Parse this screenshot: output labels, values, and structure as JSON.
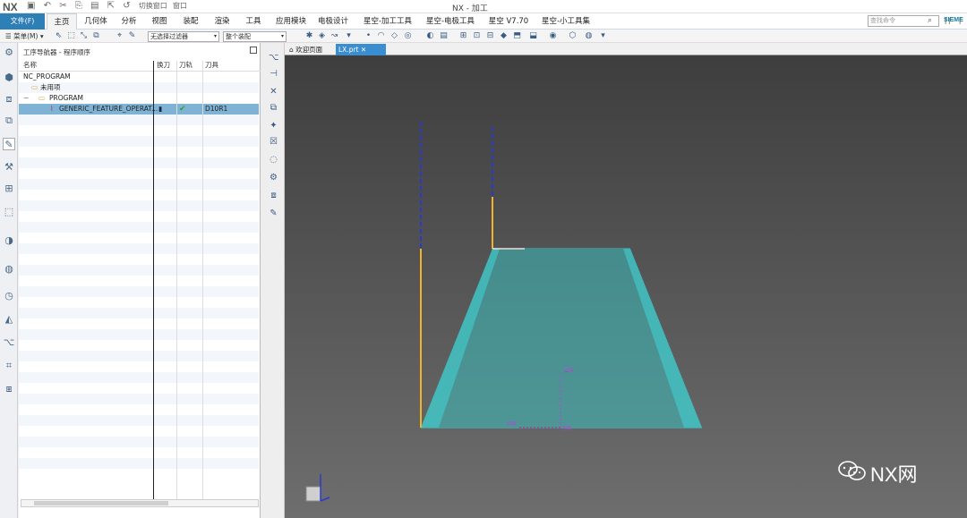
{
  "title_bar": {
    "logo": "NX",
    "title": "NX - 加工",
    "quick_access": {
      "switch_window": "切换窗口",
      "window": "窗口"
    }
  },
  "menu": {
    "file": "文件(F)",
    "tabs": [
      "主页",
      "几何体",
      "分析",
      "视图",
      "装配",
      "渲染",
      "工具",
      "应用模块",
      "电极设计",
      "星空-加工工具",
      "星空-电极工具",
      "星空 V7.70",
      "星空-小工具集"
    ],
    "active_tab": "主页",
    "search_placeholder": "查找命令",
    "brand": "SIEME"
  },
  "toolbar": {
    "menu_label": "菜单(M)",
    "filter_select": "无选择过滤器",
    "assembly_select": "整个装配"
  },
  "navigator": {
    "title": "工序导航器 - 程序顺序",
    "columns": [
      "名称",
      "换刀",
      "刀轨",
      "刀具"
    ],
    "rows": [
      {
        "name": "NC_PROGRAM",
        "swap": "",
        "path": "",
        "tool": ""
      },
      {
        "name": "未用项",
        "swap": "",
        "path": "",
        "tool": ""
      },
      {
        "name": "PROGRAM",
        "swap": "",
        "path": "",
        "tool": ""
      },
      {
        "name": "GENERIC_FEATURE_OPERAT...",
        "swap": "",
        "path": "✔",
        "tool": "D10R1"
      }
    ]
  },
  "tabs": {
    "welcome": "欢迎页面",
    "part": "LX.prt"
  },
  "viewport": {
    "axis_zm": "ZM",
    "axis_xm": "XM",
    "axis_ym": "YM",
    "toolpath_color": "#35d2d4",
    "engage_color": "#f0b429",
    "rapid_color": "#2a3bcc"
  },
  "watermark": {
    "text": "NX网"
  },
  "icons": [
    "save-icon",
    "undo-icon",
    "cut-icon",
    "copy-icon",
    "paste-icon",
    "search-icon",
    "close-icon",
    "check-icon",
    "wechat-icon"
  ]
}
